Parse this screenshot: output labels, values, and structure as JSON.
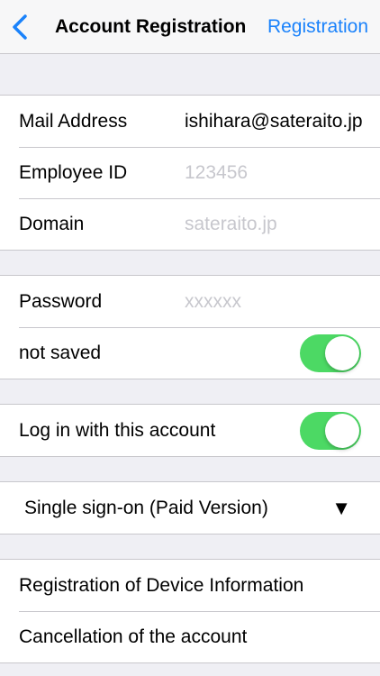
{
  "navbar": {
    "back_icon": "chevron-left-icon",
    "title": "Account Registration",
    "action_label": "Registration"
  },
  "account": {
    "mail_label": "Mail Address",
    "mail_value": "ishihara@sateraito.jp",
    "employee_label": "Employee ID",
    "employee_placeholder": "123456",
    "domain_label": "Domain",
    "domain_placeholder": "sateraito.jp"
  },
  "password_group": {
    "password_label": "Password",
    "password_placeholder": "xxxxxx",
    "not_saved_label": "not saved",
    "not_saved_toggle": true
  },
  "login_group": {
    "login_label": "Log in with this account",
    "login_toggle": true
  },
  "sso": {
    "label": "Single sign-on (Paid Version)",
    "arrow": "▼"
  },
  "actions": {
    "register_device": "Registration of Device Information",
    "cancel_account": "Cancellation of the account"
  },
  "colors": {
    "accent": "#1a82fb",
    "toggle_on": "#4cd964",
    "background": "#efeff4"
  }
}
